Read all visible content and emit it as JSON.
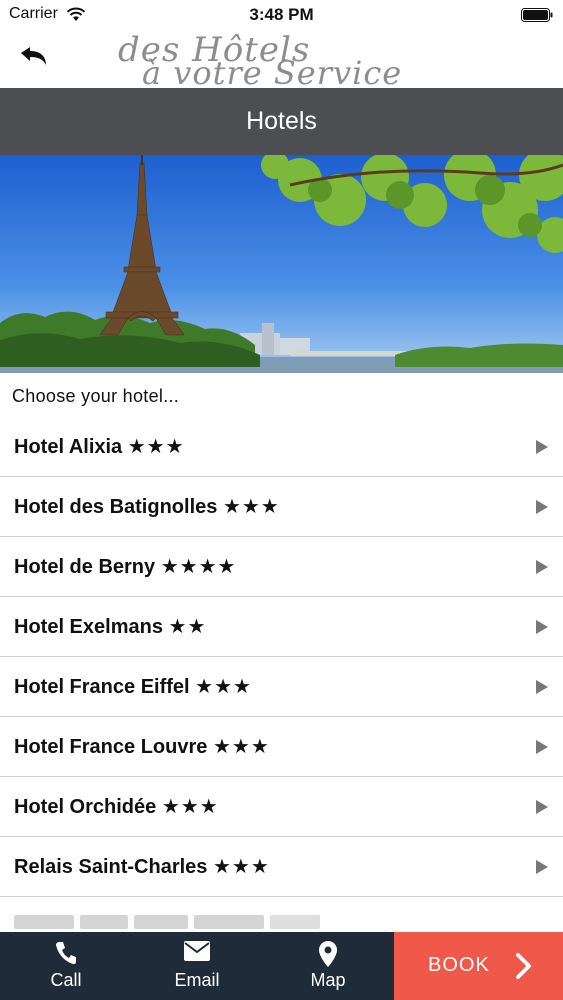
{
  "status_bar": {
    "carrier": "Carrier",
    "time": "3:48 PM"
  },
  "header": {
    "logo_line1": "des Hôtels",
    "logo_line2": "à votre Service"
  },
  "title_bar": {
    "title": "Hotels"
  },
  "intro": {
    "text": "Choose your hotel..."
  },
  "hotels": [
    {
      "name": "Hotel Alixia",
      "stars": "★★★"
    },
    {
      "name": "Hotel des Batignolles",
      "stars": "★★★"
    },
    {
      "name": "Hotel de Berny",
      "stars": "★★★★"
    },
    {
      "name": "Hotel Exelmans",
      "stars": "★★"
    },
    {
      "name": "Hotel France Eiffel",
      "stars": "★★★"
    },
    {
      "name": "Hotel France Louvre",
      "stars": "★★★"
    },
    {
      "name": "Hotel Orchidée",
      "stars": "★★★"
    },
    {
      "name": "Relais Saint-Charles",
      "stars": "★★★"
    }
  ],
  "tab_bar": {
    "call_label": "Call",
    "email_label": "Email",
    "map_label": "Map",
    "book_label": "BOOK"
  },
  "icons": {
    "wifi": "wifi-icon",
    "battery": "battery-icon",
    "back": "back-icon",
    "chevron": "chevron-right-icon",
    "phone": "phone-icon",
    "email": "envelope-icon",
    "map": "map-pin-icon",
    "book_arrow": "chevron-right-icon"
  },
  "colors": {
    "title_bar": "#4c4e52",
    "tab_bar": "#1f2b38",
    "book_button": "#f0584a",
    "logo_text": "#8d8d8d"
  }
}
